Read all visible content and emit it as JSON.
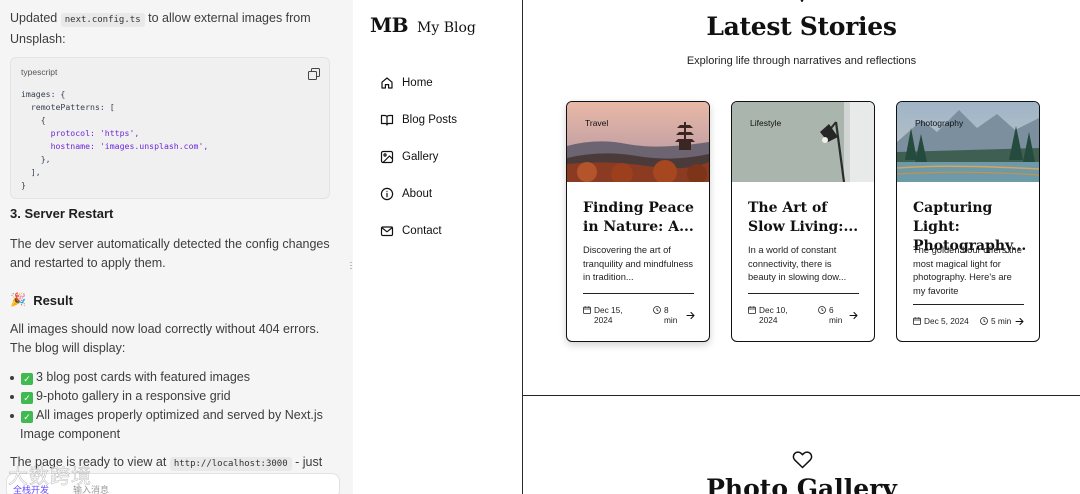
{
  "chat": {
    "intro_prefix": "Updated",
    "intro_code": "next.config.ts",
    "intro_suffix": "to allow external images from Unsplash:",
    "code_lang": "typescript",
    "code_lines": [
      "images: {",
      "  remotePatterns: [",
      "    {",
      "      protocol: 'https',",
      "      hostname: 'images.unsplash.com',",
      "    },",
      "  ],",
      "}"
    ],
    "restart_heading": "3. Server Restart",
    "restart_text": "The dev server automatically detected the config changes and restarted to apply them.",
    "result_emoji": "🎉",
    "result_heading": "Result",
    "result_text": "All images should now load correctly without 404 errors. The blog will display:",
    "result_items": [
      "3 blog post cards with featured images",
      "9-photo gallery in a responsive grid",
      "All images properly optimized and served by Next.js Image component"
    ],
    "ready_prefix": "The page is ready to view at",
    "ready_code": "http://localhost:3000",
    "ready_suffix": "- just refresh",
    "input_link": "全栈开发",
    "input_placeholder": "输入消息"
  },
  "sidebar": {
    "logo_mark": "MB",
    "logo_text": "My Blog",
    "nav": [
      {
        "label": "Home",
        "icon": "home-icon"
      },
      {
        "label": "Blog Posts",
        "icon": "book-icon"
      },
      {
        "label": "Gallery",
        "icon": "image-icon"
      },
      {
        "label": "About",
        "icon": "info-icon"
      },
      {
        "label": "Contact",
        "icon": "mail-icon"
      }
    ]
  },
  "main": {
    "title": "Latest Stories",
    "subtitle": "Exploring life through narratives and reflections",
    "cards": [
      {
        "tag": "Travel",
        "title": "Finding Peace in Nature: A...",
        "excerpt": "Discovering the art of tranquility and mindfulness in tradition...",
        "date": "Dec 15, 2024",
        "read_time": "8 min"
      },
      {
        "tag": "Lifestyle",
        "title": "The Art of Slow Living:...",
        "excerpt": "In a world of constant connectivity, there is beauty in slowing dow...",
        "date": "Dec 10, 2024",
        "read_time": "6 min"
      },
      {
        "tag": "Photography",
        "title": "Capturing Light: Photography...",
        "excerpt": "The golden hour offers the most magical light for photography. Here's are my favorite",
        "date": "Dec 5, 2024",
        "read_time": "5 min"
      }
    ],
    "gallery_title": "Photo Gallery"
  },
  "watermark": "大数跨境",
  "colors": {
    "accent": "#6b4eff",
    "check": "#3fb950",
    "text": "#111111"
  }
}
